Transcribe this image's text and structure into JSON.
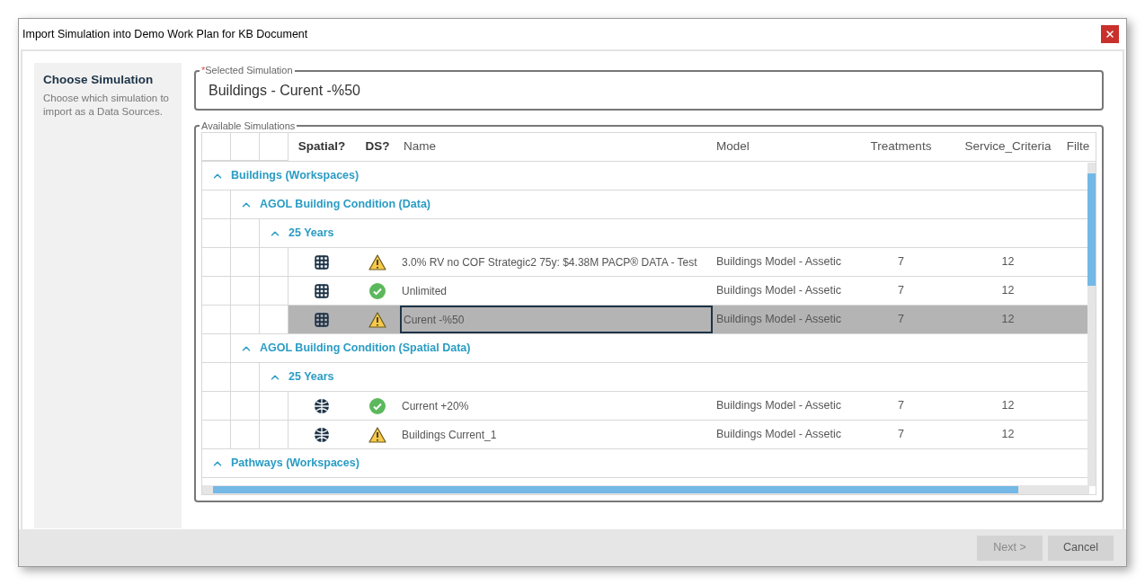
{
  "window": {
    "title": "Import Simulation into Demo Work Plan for KB Document"
  },
  "sidebar": {
    "title": "Choose Simulation",
    "description": "Choose which simulation to import as a Data Sources."
  },
  "selected_field": {
    "required_mark": "*",
    "label": "Selected Simulation",
    "value": "Buildings - Curent -%50"
  },
  "available": {
    "label": "Available Simulations",
    "columns": [
      "Spatial?",
      "DS?",
      "Name",
      "Model",
      "Treatments",
      "Service_Criteria",
      "Filte"
    ],
    "tree": [
      {
        "kind": "group",
        "label": "Buildings (Workspaces)",
        "expanded": true,
        "children": [
          {
            "kind": "group",
            "label": "AGOL Building Condition (Data)",
            "expanded": true,
            "children": [
              {
                "kind": "group",
                "label": "25 Years",
                "expanded": true,
                "children": [
                  {
                    "kind": "row",
                    "spatial": false,
                    "ds_warning": true,
                    "name": "3.0% RV no COF Strategic2 75y: $4.38M PACP® DATA - Test",
                    "model": "Buildings Model - Assetic",
                    "treatments": "7",
                    "service_criteria": "12",
                    "selected": false
                  },
                  {
                    "kind": "row",
                    "spatial": false,
                    "ds_warning": false,
                    "name": "Unlimited",
                    "model": "Buildings Model - Assetic",
                    "treatments": "7",
                    "service_criteria": "12",
                    "selected": false
                  },
                  {
                    "kind": "row",
                    "spatial": false,
                    "ds_warning": true,
                    "name": "Curent -%50",
                    "model": "Buildings Model - Assetic",
                    "treatments": "7",
                    "service_criteria": "12",
                    "selected": true
                  }
                ]
              }
            ]
          },
          {
            "kind": "group",
            "label": "AGOL Building Condition (Spatial Data)",
            "expanded": true,
            "children": [
              {
                "kind": "group",
                "label": "25 Years",
                "expanded": true,
                "children": [
                  {
                    "kind": "row",
                    "spatial": true,
                    "ds_warning": false,
                    "name": "Current +20%",
                    "model": "Buildings Model - Assetic",
                    "treatments": "7",
                    "service_criteria": "12",
                    "selected": false
                  },
                  {
                    "kind": "row",
                    "spatial": true,
                    "ds_warning": true,
                    "name": "Buildings Current_1",
                    "model": "Buildings Model - Assetic",
                    "treatments": "7",
                    "service_criteria": "12",
                    "selected": false
                  }
                ]
              }
            ]
          }
        ]
      },
      {
        "kind": "group",
        "label": "Pathways (Workspaces)",
        "expanded": true
      }
    ]
  },
  "footer": {
    "buttons": [
      {
        "label": "Next >",
        "disabled": true
      },
      {
        "label": "Cancel",
        "disabled": false
      }
    ]
  }
}
